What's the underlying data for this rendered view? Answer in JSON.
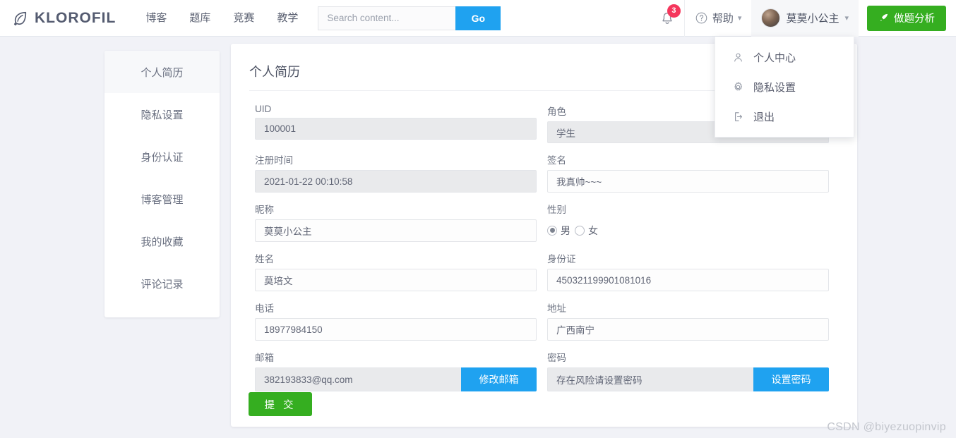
{
  "header": {
    "brand": "KLOROFIL",
    "brand_icon": "leaf-icon",
    "nav": [
      {
        "label": "博客"
      },
      {
        "label": "题库"
      },
      {
        "label": "竞赛"
      },
      {
        "label": "教学"
      }
    ],
    "search": {
      "value": "",
      "placeholder": "Search content...",
      "button": "Go"
    },
    "notifications": {
      "icon": "bell-icon",
      "count": "3"
    },
    "help": {
      "icon": "question-circle-icon",
      "label": "帮助",
      "caret": "chevron-down-icon"
    },
    "user": {
      "avatar": "user-avatar",
      "name": "莫莫小公主",
      "caret": "chevron-down-icon"
    },
    "analyze_button": {
      "icon": "rocket-icon",
      "label": "做题分析"
    }
  },
  "user_menu": {
    "items": [
      {
        "icon": "user-icon",
        "label": "个人中心"
      },
      {
        "icon": "gear-icon",
        "label": "隐私设置"
      },
      {
        "icon": "logout-icon",
        "label": "退出"
      }
    ]
  },
  "sidebar": {
    "items": [
      {
        "label": "个人简历",
        "active": true
      },
      {
        "label": "隐私设置",
        "active": false
      },
      {
        "label": "身份认证",
        "active": false
      },
      {
        "label": "博客管理",
        "active": false
      },
      {
        "label": "我的收藏",
        "active": false
      },
      {
        "label": "评论记录",
        "active": false
      }
    ]
  },
  "main": {
    "title": "个人简历",
    "fields": {
      "uid": {
        "label": "UID",
        "value": "100001"
      },
      "role": {
        "label": "角色",
        "value": "学生"
      },
      "register_time": {
        "label": "注册时间",
        "value": "2021-01-22 00:10:58"
      },
      "signature": {
        "label": "签名",
        "value": "我真帅~~~"
      },
      "nickname": {
        "label": "昵称",
        "value": "莫莫小公主"
      },
      "gender": {
        "label": "性别",
        "male": "男",
        "female": "女",
        "selected": "男"
      },
      "realname": {
        "label": "姓名",
        "value": "莫培文"
      },
      "idcard": {
        "label": "身份证",
        "value": "450321199901081016"
      },
      "phone": {
        "label": "电话",
        "value": "18977984150"
      },
      "address": {
        "label": "地址",
        "value": "广西南宁"
      },
      "email": {
        "label": "邮箱",
        "value": "382193833@qq.com",
        "button": "修改邮箱"
      },
      "password": {
        "label": "密码",
        "value": "存在风险请设置密码",
        "button": "设置密码"
      }
    },
    "submit_label": "提 交"
  },
  "watermark": "CSDN @biyezuopinvip",
  "colors": {
    "page_bg": "#f1f2f7",
    "accent_blue": "#1fa2f0",
    "accent_green": "#35ae20",
    "badge_red": "#f5365c",
    "brand_text": "#545b70"
  }
}
